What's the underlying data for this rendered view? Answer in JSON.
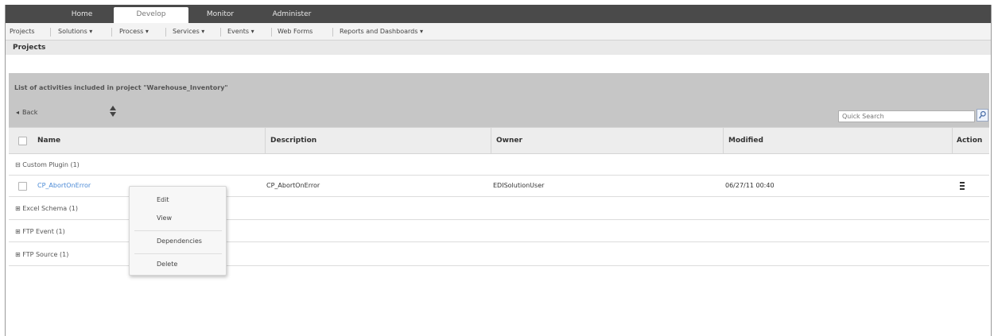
{
  "top_tabs": [
    "Home",
    "Develop",
    "Monitor",
    "Administer"
  ],
  "submenu": [
    "Projects",
    "Solutions ▾",
    "Process ▾",
    "Services ▾",
    "Events ▾",
    "Web Forms",
    "Reports and Dashboards ▾"
  ],
  "page_title": "Projects",
  "panel": {
    "description": "List of activities included in project \"Warehouse_Inventory\"",
    "back_label": "Back",
    "search_placeholder": "Quick Search"
  },
  "table": {
    "columns": [
      "Name",
      "Description",
      "Owner",
      "Modified",
      "Action"
    ],
    "groups": [
      {
        "label": "⊟ Custom Plugin (1)"
      },
      {
        "label": "⊞ Excel Schema (1)"
      },
      {
        "label": "⊞ FTP Event (1)"
      },
      {
        "label": "⊞ FTP Source (1)"
      }
    ],
    "rows": [
      {
        "name": "CP_AbortOnError",
        "description": "CP_AbortOnError",
        "owner": "EDISolutionUser",
        "modified": "06/27/11 00:40"
      }
    ]
  },
  "context_menu": [
    "Edit",
    "View",
    "Dependencies",
    "Delete"
  ]
}
